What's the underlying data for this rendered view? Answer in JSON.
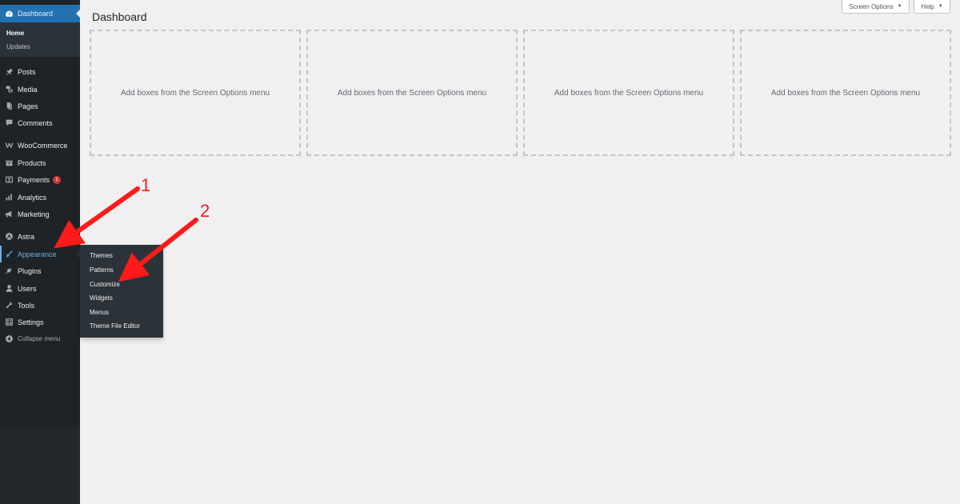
{
  "sidebar": {
    "dashboard": {
      "label": "Dashboard",
      "icon": "gauge-icon"
    },
    "dashboard_sub": {
      "home": "Home",
      "updates": "Updates"
    },
    "items": [
      {
        "label": "Posts",
        "icon": "pushpin-icon"
      },
      {
        "label": "Media",
        "icon": "media-icon"
      },
      {
        "label": "Pages",
        "icon": "pages-icon"
      },
      {
        "label": "Comments",
        "icon": "comment-icon"
      },
      {
        "label": "WooCommerce",
        "icon": "woocommerce-icon"
      },
      {
        "label": "Products",
        "icon": "products-icon"
      },
      {
        "label": "Payments",
        "icon": "payments-icon",
        "badge": "1"
      },
      {
        "label": "Analytics",
        "icon": "analytics-icon"
      },
      {
        "label": "Marketing",
        "icon": "megaphone-icon"
      },
      {
        "label": "Astra",
        "icon": "astra-icon"
      },
      {
        "label": "Appearance",
        "icon": "brush-icon"
      },
      {
        "label": "Plugins",
        "icon": "plug-icon"
      },
      {
        "label": "Users",
        "icon": "user-icon"
      },
      {
        "label": "Tools",
        "icon": "wrench-icon"
      },
      {
        "label": "Settings",
        "icon": "settings-icon"
      },
      {
        "label": "Collapse menu",
        "icon": "collapse-icon"
      }
    ]
  },
  "flyout": {
    "items": [
      "Themes",
      "Patterns",
      "Customize",
      "Widgets",
      "Menus",
      "Theme File Editor"
    ]
  },
  "header": {
    "title": "Dashboard",
    "screen_options": "Screen Options",
    "help": "Help"
  },
  "boxes": [
    "Add boxes from the Screen Options menu",
    "Add boxes from the Screen Options menu",
    "Add boxes from the Screen Options menu",
    "Add boxes from the Screen Options menu"
  ],
  "annotations": {
    "one": "1",
    "two": "2"
  },
  "colors": {
    "accent": "#2271b1",
    "sidebar": "#1d2327",
    "active_text": "#72aee6",
    "arrow": "#ff1a1a"
  }
}
